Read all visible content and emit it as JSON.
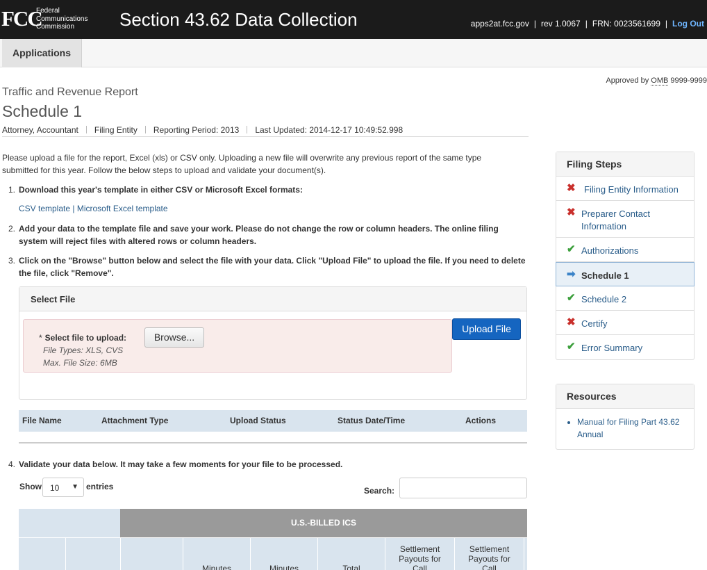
{
  "header": {
    "logo_mark": "FCC",
    "logo_lines": [
      "Federal",
      "Communications",
      "Commission"
    ],
    "title": "Section 43.62 Data Collection",
    "host": "apps2at.fcc.gov",
    "rev": "rev 1.0067",
    "frn": "FRN: 0023561699",
    "logout": "Log Out"
  },
  "nav": {
    "applications": "Applications"
  },
  "omb": {
    "prefix": "Approved by ",
    "abbr": "OMB",
    "number": " 9999-9999"
  },
  "page": {
    "report": "Traffic and Revenue Report",
    "title": "Schedule 1",
    "meta": [
      "Attorney, Accountant",
      "Filing Entity",
      "Reporting Period: 2013",
      "Last Updated: 2014-12-17 10:49:52.998"
    ]
  },
  "intro": "Please upload a file for the report, Excel (xls) or CSV only. Uploading a new file will overwrite any previous report of the same type submitted for this year. Follow the below steps to upload and validate your document(s).",
  "steps": [
    {
      "num": "1.",
      "text": "Download this year's template in either CSV or Microsoft Excel formats:"
    },
    {
      "num": "2.",
      "text": "Add your data to the template file and save your work. Please do not change the row or column headers. The online filing system will reject files with altered rows or column headers."
    },
    {
      "num": "3.",
      "text": "Click on the \"Browse\" button below and select the file with your data. Click \"Upload File\" to upload the file. If you need to delete the file, click \"Remove\"."
    },
    {
      "num": "4.",
      "text": "Validate your data below. It may take a few moments for your file to be processed."
    }
  ],
  "templates": {
    "csv": "CSV template",
    "sep": " | ",
    "excel": "Microsoft Excel template"
  },
  "select_file": {
    "heading": "Select File",
    "star": "*",
    "label": "Select file to upload:",
    "types": "File Types: XLS, CVS",
    "max": "Max. File Size: 6MB",
    "browse": "Browse...",
    "upload": "Upload File"
  },
  "files_table": {
    "columns": [
      "File Name",
      "Attachment Type",
      "Upload Status",
      "Status Date/Time",
      "Actions"
    ]
  },
  "datatable": {
    "show": "Show",
    "show_value": "10",
    "entries": "entries",
    "search": "Search:",
    "group_header": "U.S.-BILLED ICS",
    "columns": [
      "",
      "",
      "",
      "Minutes",
      "Minutes",
      "Total",
      "Settlement Payouts for Call",
      "Settlement Payouts for Call"
    ]
  },
  "filing_steps": {
    "heading": "Filing Steps",
    "items": [
      {
        "label": "Filing Entity Information",
        "status": "incomplete"
      },
      {
        "label": "Preparer Contact Information",
        "status": "incomplete"
      },
      {
        "label": "Authorizations",
        "status": "complete"
      },
      {
        "label": "Schedule 1",
        "status": "current"
      },
      {
        "label": "Schedule 2",
        "status": "complete"
      },
      {
        "label": "Certify",
        "status": "incomplete"
      },
      {
        "label": "Error Summary",
        "status": "complete"
      }
    ]
  },
  "resources": {
    "heading": "Resources",
    "items": [
      "Manual for Filing Part 43.62 Annual"
    ]
  },
  "colors": {
    "header_bg": "#1b1b1b",
    "primary_button": "#1565c0",
    "error_bg": "#f9ecea",
    "table_head": "#d9e4ee",
    "group_head": "#9a9a9a",
    "link": "#2a5d8a"
  }
}
